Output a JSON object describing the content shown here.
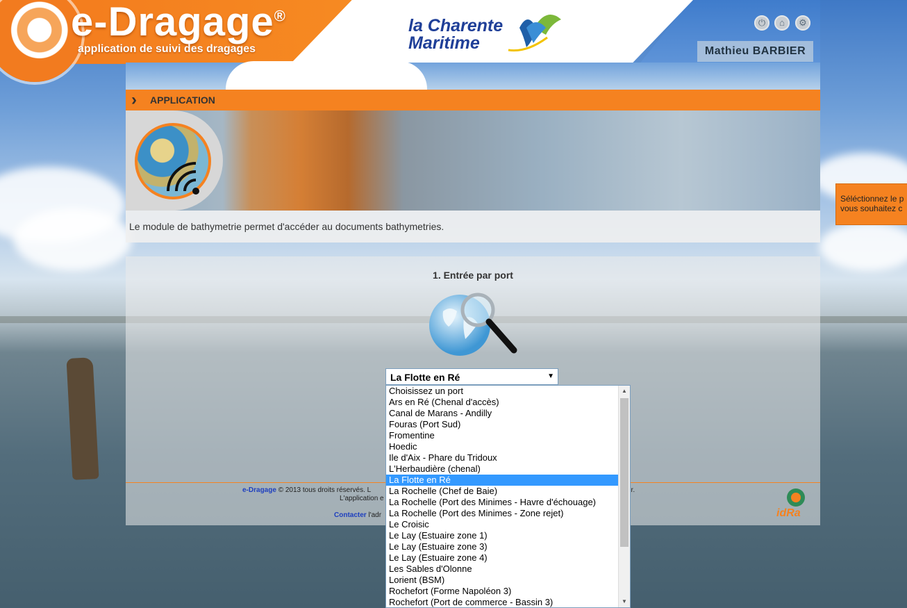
{
  "brand": {
    "name": "e-Dragage",
    "registered": "®",
    "tagline": "application de suivi des dragages"
  },
  "partner": {
    "line1": "la Charente",
    "line2": "Maritime"
  },
  "header": {
    "icons": [
      "logout-icon",
      "home-icon",
      "settings-icon"
    ],
    "user_name": "Mathieu BARBIER"
  },
  "section": {
    "title": "APPLICATION",
    "description": "Le module de bathymetrie permet d'accéder au documents bathymetries."
  },
  "port_entry": {
    "title": "1. Entrée par port",
    "selected_value": "La Flotte en Ré",
    "options": [
      "Choisissez un port",
      "Ars en Ré (Chenal d'accès)",
      "Canal de Marans - Andilly",
      "Fouras (Port Sud)",
      "Fromentine",
      "Hoedic",
      "Ile d'Aix - Phare du Tridoux",
      "L'Herbaudière (chenal)",
      "La Flotte en Ré",
      "La Rochelle (Chef de Baie)",
      "La Rochelle (Port des Minimes - Havre d'échouage)",
      "La Rochelle (Port des Minimes - Zone rejet)",
      "Le Croisic",
      "Le Lay (Estuaire zone 1)",
      "Le Lay (Estuaire zone 3)",
      "Le Lay (Estuaire zone 4)",
      "Les Sables d'Olonne",
      "Lorient (BSM)",
      "Rochefort (Forme Napoléon 3)",
      "Rochefort (Port de commerce - Bassin 3)"
    ],
    "selected_index": 8
  },
  "footer": {
    "brand_link": "e-Dragage",
    "copyright": "© 2013 tous droits réservés. L",
    "copyright_end": "ur.",
    "line2": "L'application e",
    "contact_link": "Contacter",
    "contact_rest": "l'adr",
    "partner_logo": "idRa"
  },
  "tooltip": {
    "line1": "Séléctionnez le p",
    "line2": "vous souhaitez c"
  },
  "colors": {
    "accent": "#f58220",
    "selection": "#3399ff",
    "link": "#1e3fbf"
  }
}
